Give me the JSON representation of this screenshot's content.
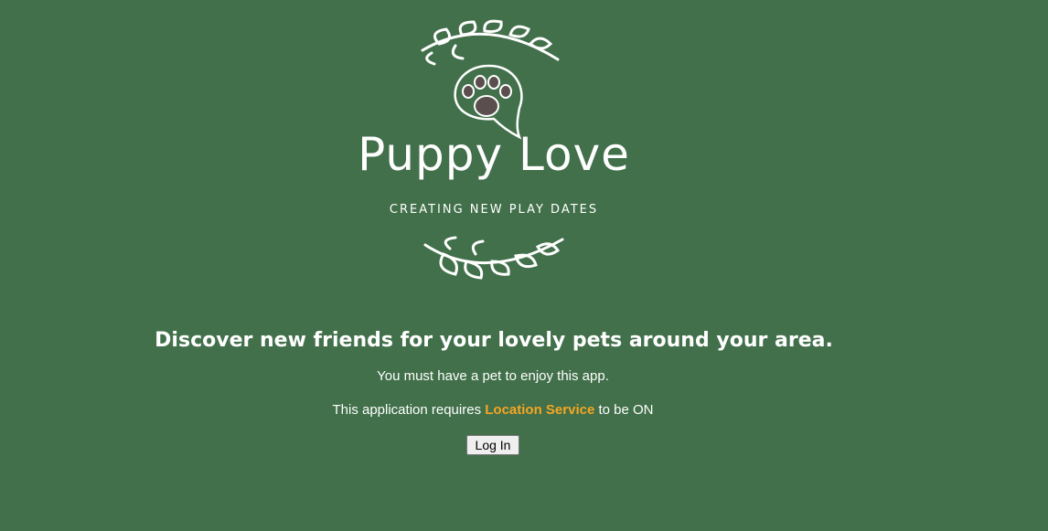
{
  "logo": {
    "title": "Puppy Love",
    "tagline": "CREATING NEW PLAY DATES",
    "icon": "paw-speech-bubble-icon"
  },
  "main": {
    "headline": "Discover new friends for your lovely pets around your area.",
    "requirement_pet": "You must have a pet to enjoy this app.",
    "requirement_location_prefix": "This application requires ",
    "requirement_location_highlight": "Location Service",
    "requirement_location_suffix": " to be ON",
    "login_label": "Log In"
  },
  "colors": {
    "background": "#41704a",
    "text": "#ffffff",
    "highlight": "#f5a623"
  }
}
